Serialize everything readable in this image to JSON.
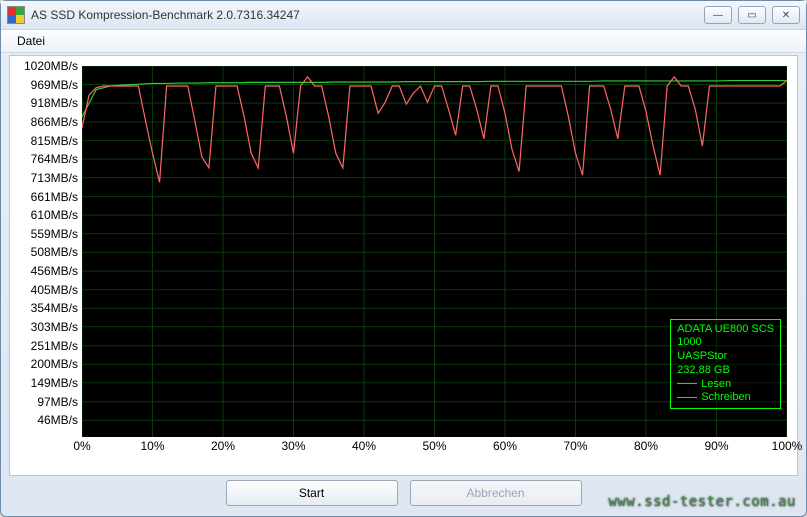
{
  "window": {
    "title": "AS SSD Kompression-Benchmark 2.0.7316.34247"
  },
  "menubar": {
    "file": "Datei"
  },
  "buttons": {
    "start": "Start",
    "abort": "Abbrechen"
  },
  "legend": {
    "device": "ADATA UE800 SCS",
    "fw": "1000",
    "driver": "UASPStor",
    "capacity": "232,88 GB",
    "read": "Lesen",
    "write": "Schreiben"
  },
  "watermark": "www.ssd-tester.com.au",
  "chart_data": {
    "type": "line",
    "xlabel": "",
    "ylabel": "",
    "xlim": [
      0,
      100
    ],
    "ylim": [
      0,
      1020
    ],
    "y_ticks": [
      46,
      97,
      149,
      200,
      251,
      303,
      354,
      405,
      456,
      508,
      559,
      610,
      661,
      713,
      764,
      815,
      866,
      918,
      969,
      1020
    ],
    "y_tick_suffix": "MB/s",
    "x_ticks": [
      0,
      10,
      20,
      30,
      40,
      50,
      60,
      70,
      80,
      90,
      100
    ],
    "x_tick_suffix": "%",
    "series": [
      {
        "name": "Lesen",
        "color": "#33cc33",
        "x": [
          0,
          2,
          4,
          6,
          8,
          10,
          12,
          14,
          16,
          18,
          20,
          22,
          24,
          26,
          28,
          30,
          32,
          34,
          36,
          38,
          40,
          42,
          44,
          46,
          48,
          50,
          52,
          54,
          56,
          58,
          60,
          62,
          64,
          66,
          68,
          70,
          72,
          74,
          76,
          78,
          80,
          82,
          84,
          86,
          88,
          90,
          92,
          94,
          96,
          98,
          100
        ],
        "y": [
          880,
          955,
          965,
          968,
          970,
          972,
          972,
          973,
          973,
          974,
          974,
          974,
          975,
          975,
          975,
          975,
          975,
          975,
          976,
          976,
          976,
          976,
          976,
          977,
          977,
          977,
          977,
          977,
          977,
          978,
          978,
          978,
          978,
          978,
          978,
          978,
          978,
          979,
          979,
          979,
          979,
          979,
          979,
          979,
          979,
          979,
          980,
          980,
          980,
          980,
          980
        ]
      },
      {
        "name": "Schreiben",
        "color": "#ff6666",
        "x": [
          0,
          1,
          2,
          3,
          4,
          5,
          6,
          7,
          8,
          9,
          10,
          11,
          12,
          13,
          14,
          15,
          16,
          17,
          18,
          19,
          20,
          21,
          22,
          23,
          24,
          25,
          26,
          27,
          28,
          29,
          30,
          31,
          32,
          33,
          34,
          35,
          36,
          37,
          38,
          39,
          40,
          41,
          42,
          43,
          44,
          45,
          46,
          47,
          48,
          49,
          50,
          51,
          52,
          53,
          54,
          55,
          56,
          57,
          58,
          59,
          60,
          61,
          62,
          63,
          64,
          65,
          66,
          67,
          68,
          69,
          70,
          71,
          72,
          73,
          74,
          75,
          76,
          77,
          78,
          79,
          80,
          81,
          82,
          83,
          84,
          85,
          86,
          87,
          88,
          89,
          90,
          91,
          92,
          93,
          94,
          95,
          96,
          97,
          98,
          99,
          100
        ],
        "y": [
          850,
          940,
          960,
          965,
          965,
          965,
          965,
          965,
          965,
          870,
          780,
          700,
          965,
          965,
          965,
          965,
          870,
          770,
          740,
          965,
          965,
          965,
          965,
          880,
          780,
          740,
          965,
          965,
          965,
          880,
          780,
          965,
          990,
          965,
          965,
          880,
          780,
          740,
          965,
          965,
          965,
          965,
          890,
          920,
          965,
          965,
          915,
          945,
          965,
          920,
          965,
          965,
          900,
          830,
          965,
          965,
          900,
          820,
          965,
          965,
          890,
          790,
          730,
          965,
          965,
          965,
          965,
          965,
          965,
          880,
          780,
          720,
          965,
          965,
          965,
          900,
          820,
          965,
          965,
          965,
          895,
          800,
          720,
          965,
          990,
          965,
          965,
          900,
          800,
          965,
          965,
          965,
          965,
          965,
          965,
          965,
          965,
          965,
          965,
          965,
          980
        ]
      }
    ]
  }
}
